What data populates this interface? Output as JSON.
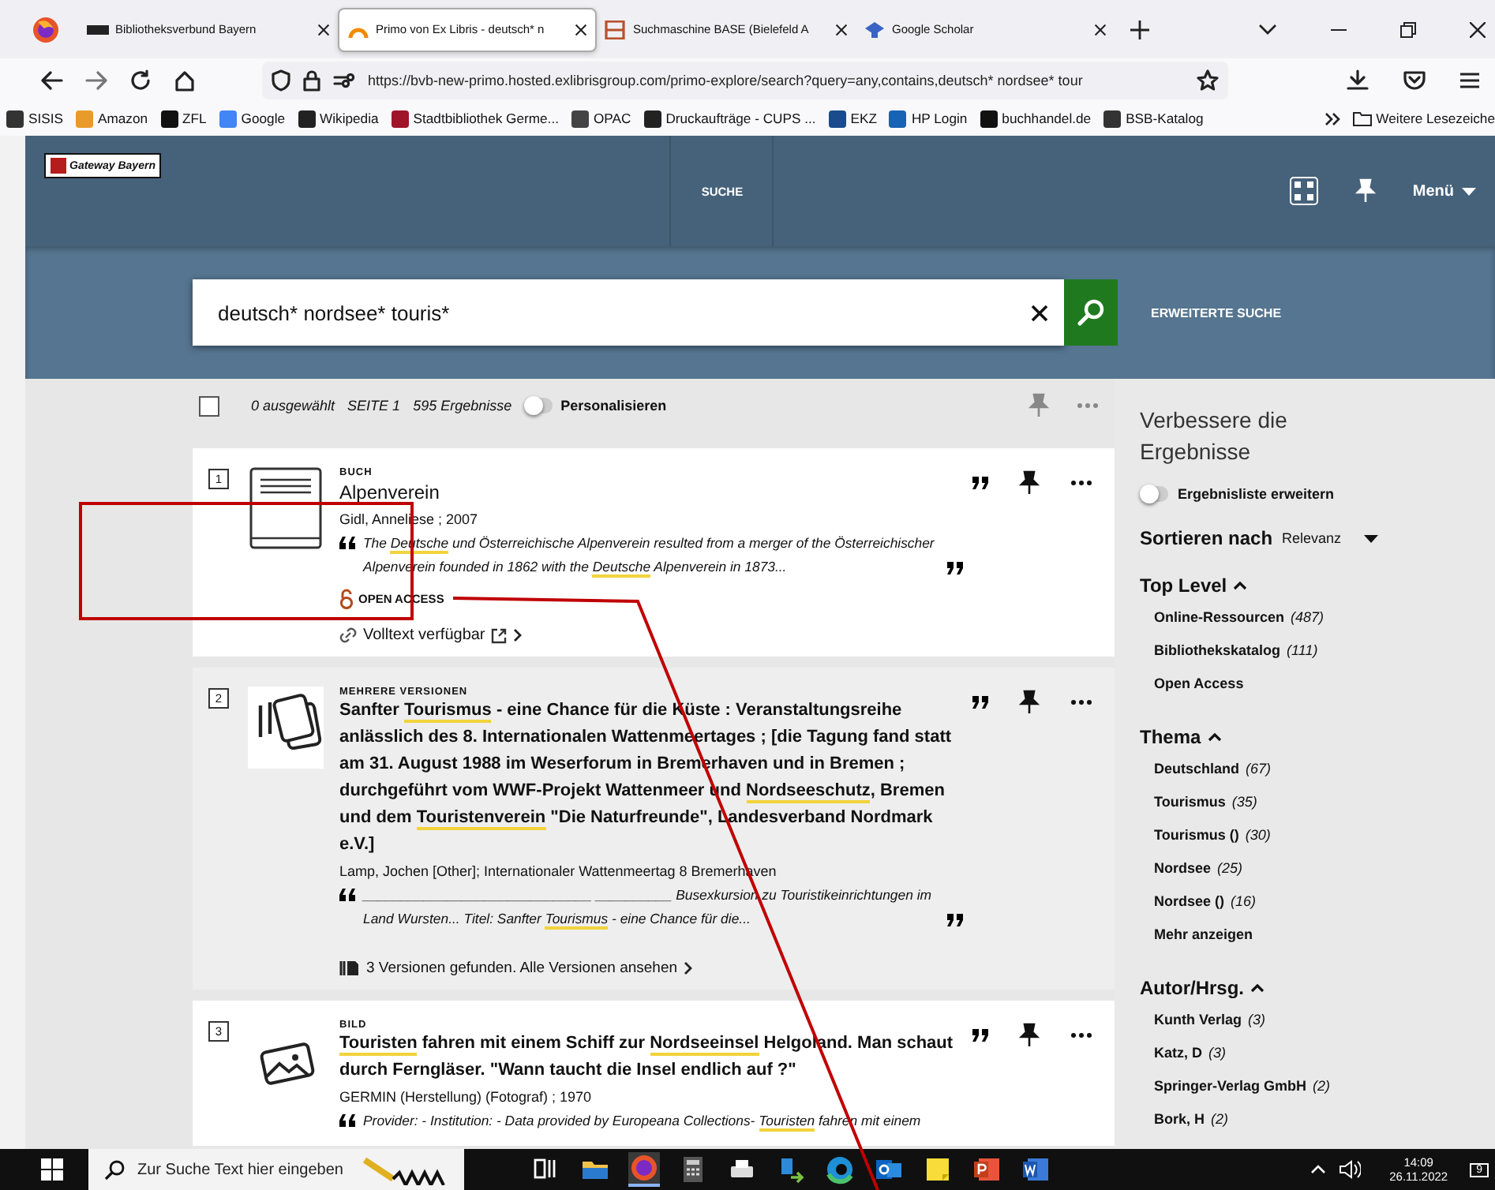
{
  "browser": {
    "tabs": [
      {
        "title": "Bibliotheksverbund Bayern",
        "selected": false
      },
      {
        "title": "Primo von Ex Libris - deutsch* n",
        "selected": true
      },
      {
        "title": "Suchmaschine BASE (Bielefeld A",
        "selected": false
      },
      {
        "title": "Google Scholar",
        "selected": false
      }
    ],
    "url": "https://bvb-new-primo.hosted.exlibrisgroup.com/primo-explore/search?query=any,contains,deutsch* nordsee* tour",
    "bookmarks": [
      {
        "label": "SISIS"
      },
      {
        "label": "Amazon"
      },
      {
        "label": "ZFL"
      },
      {
        "label": "Google"
      },
      {
        "label": "Wikipedia"
      },
      {
        "label": "Stadtbibliothek Germe..."
      },
      {
        "label": "OPAC"
      },
      {
        "label": "Druckaufträge - CUPS ..."
      },
      {
        "label": "EKZ"
      },
      {
        "label": "HP Login"
      },
      {
        "label": "buchhandel.de"
      },
      {
        "label": "BSB-Katalog"
      }
    ],
    "other_bookmarks": "Weitere Lesezeiche"
  },
  "header": {
    "logo_text": "Gateway Bayern",
    "nav": [
      {
        "label": "SUCHE"
      }
    ],
    "menu_label": "Menü"
  },
  "search": {
    "value": "deutsch* nordsee* touris*",
    "advanced_link": "ERWEITERTE SUCHE"
  },
  "results_bar": {
    "all_selected": false,
    "selected_count": "0 ausgewählt",
    "page": "SEITE 1",
    "total": "595 Ergebnisse",
    "personalize": {
      "label": "Personalisieren",
      "on": false
    }
  },
  "results": [
    {
      "number": "1",
      "kind": "book",
      "type": "BUCH",
      "highlighted": false,
      "title": [
        {
          "text": "Alpenverein",
          "hit": false
        }
      ],
      "author": "Gidl, Anneliese ; 2007",
      "snippet": [
        {
          "text": "The ",
          "hit": false
        },
        {
          "text": "Deutsche",
          "hit": true
        },
        {
          "text": " und Österreichische Alpenverein resulted from a merger of the Österreichischer Alpenverein founded in 1862 with the ",
          "hit": false
        },
        {
          "text": "Deutsche",
          "hit": true
        },
        {
          "text": " Alpenverein in 1873...",
          "hit": false
        }
      ],
      "quote_closed": true,
      "open_access": "OPEN ACCESS",
      "footer": {
        "kind": "fulltext",
        "text": "Volltext verfügbar"
      }
    },
    {
      "number": "2",
      "kind": "versions",
      "type": "MEHRERE VERSIONEN",
      "highlighted": true,
      "title": [
        {
          "text": "Sanfter ",
          "hit": false
        },
        {
          "text": "Tourismus",
          "hit": true
        },
        {
          "text": " - eine Chance für die Küste : Veranstaltungsreihe anlässlich des 8. Internationalen Wattenmeertages ; [die Tagung fand statt am 31. August 1988 im Weserforum in Bremerhaven und in Bremen ; durchgeführt vom WWF-Projekt Wattenmeer und ",
          "hit": false
        },
        {
          "text": "Nordseeschutz",
          "hit": true
        },
        {
          "text": ", Bremen und dem ",
          "hit": false
        },
        {
          "text": "Touristenverein",
          "hit": true
        },
        {
          "text": " \"Die Naturfreunde\", Landesverband Nordmark e.V.]",
          "hit": false
        }
      ],
      "author": "Lamp, Jochen [Other]; Internationaler Wattenmeertag 8 Bremerhaven",
      "snippet": [
        {
          "text": "______________________________ __________ Busexkursion zu Touristikeinrichtungen im Land Wursten... Titel: Sanfter ",
          "hit": false
        },
        {
          "text": "Tourismus",
          "hit": true
        },
        {
          "text": " - eine Chance für die...",
          "hit": false
        }
      ],
      "quote_closed": true,
      "footer": {
        "kind": "versions",
        "text": "3 Versionen gefunden. Alle Versionen ansehen"
      }
    },
    {
      "number": "3",
      "kind": "image",
      "type": "BILD",
      "highlighted": false,
      "title": [
        {
          "text": "Touristen",
          "hit": true
        },
        {
          "text": " fahren mit einem Schiff zur ",
          "hit": false
        },
        {
          "text": "Nordseeinsel",
          "hit": true
        },
        {
          "text": " Helgoland. Man schaut durch Ferngläser. \"Wann taucht die Insel endlich auf ?\"",
          "hit": false
        }
      ],
      "author": "GERMIN (Herstellung) (Fotograf) ; 1970",
      "snippet": [
        {
          "text": "Provider: - Institution: - Data provided by Europeana Collections- ",
          "hit": false
        },
        {
          "text": "Touristen",
          "hit": true
        },
        {
          "text": " fahren mit einem",
          "hit": false
        }
      ],
      "quote_closed": false
    }
  ],
  "refine": {
    "title": "Verbessere die Ergebnisse",
    "expand_toggle": {
      "label": "Ergebnisliste erweitern",
      "on": false
    },
    "sort_label": "Sortieren nach",
    "sort_value": "Relevanz",
    "facets": [
      {
        "title": "Top Level",
        "expanded": true,
        "items": [
          {
            "label": "Online-Ressourcen",
            "count": "(487)"
          },
          {
            "label": "Bibliothekskatalog",
            "count": "(111)"
          },
          {
            "label": "Open Access"
          }
        ]
      },
      {
        "title": "Thema",
        "expanded": true,
        "items": [
          {
            "label": "Deutschland",
            "count": "(67)"
          },
          {
            "label": "Tourismus",
            "count": "(35)"
          },
          {
            "label": "Tourismus ()",
            "count": "(30)"
          },
          {
            "label": "Nordsee",
            "count": "(25)"
          },
          {
            "label": "Nordsee ()",
            "count": "(16)"
          }
        ],
        "more": "Mehr anzeigen"
      },
      {
        "title": "Autor/Hrsg.",
        "expanded": true,
        "items": [
          {
            "label": "Kunth Verlag",
            "count": "(3)"
          },
          {
            "label": "Katz, D",
            "count": "(3)"
          },
          {
            "label": "Springer-Verlag GmbH",
            "count": "(2)"
          },
          {
            "label": "Bork, H",
            "count": "(2)"
          }
        ]
      }
    ]
  },
  "overlay": {
    "kind": "callout"
  },
  "taskbar": {
    "search_placeholder": "Zur Suche Text hier eingeben",
    "apps": [
      {
        "kind": "task-view",
        "active": false
      },
      {
        "kind": "folder",
        "active": false
      },
      {
        "kind": "browser",
        "active": true
      },
      {
        "kind": "calculator",
        "active": false
      },
      {
        "kind": "printer",
        "active": false
      },
      {
        "kind": "transfer",
        "active": false
      },
      {
        "kind": "edge",
        "active": false
      },
      {
        "kind": "mail",
        "active": false
      },
      {
        "kind": "notes",
        "active": false
      },
      {
        "kind": "slides",
        "active": false
      },
      {
        "kind": "document",
        "active": false
      }
    ],
    "time": "14:09",
    "date": "26.11.2022",
    "notifications": "9"
  }
}
